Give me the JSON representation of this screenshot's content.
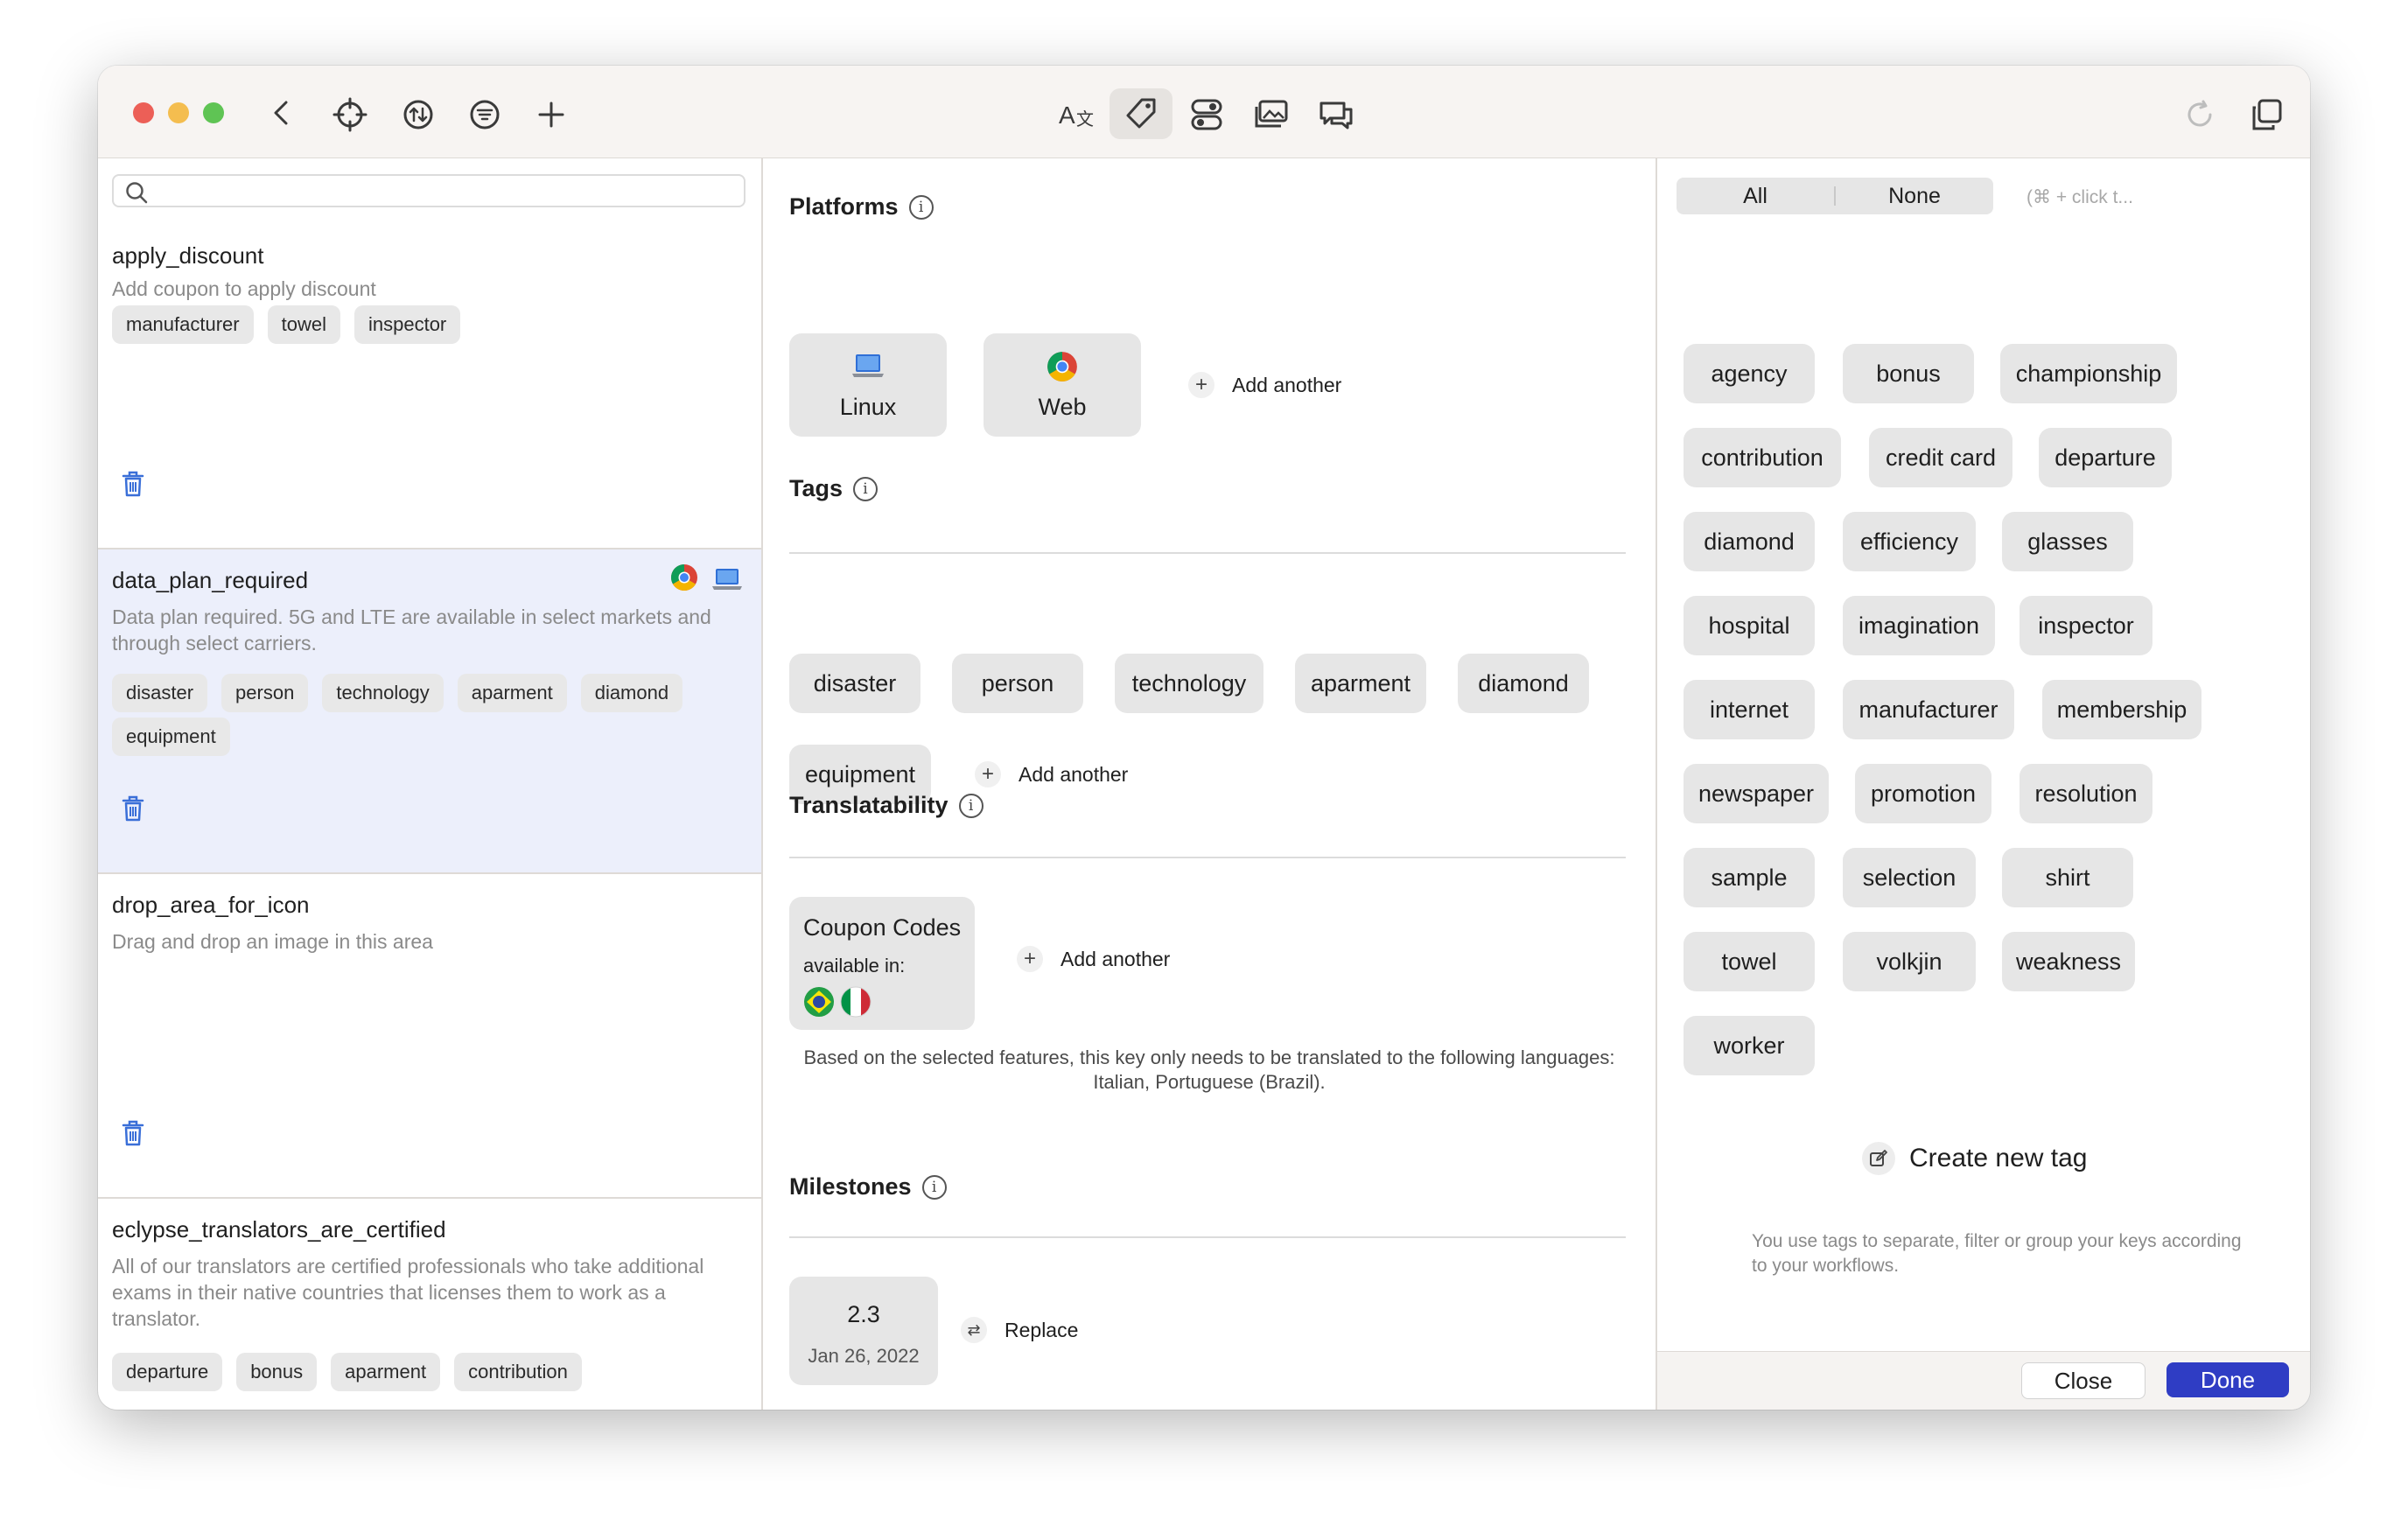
{
  "search": {
    "placeholder": ""
  },
  "keys": [
    {
      "name": "apply_discount",
      "description": "Add coupon to apply discount",
      "tags": [
        "manufacturer",
        "towel",
        "inspector"
      ]
    },
    {
      "name": "data_plan_required",
      "description": "Data plan required. 5G and LTE are available in select markets and through select carriers.",
      "tags": [
        "disaster",
        "person",
        "technology",
        "aparment",
        "diamond",
        "equipment"
      ]
    },
    {
      "name": "drop_area_for_icon",
      "description": "Drag and drop an image in this area",
      "tags": []
    },
    {
      "name": "eclypse_translators_are_certified",
      "description": "All of our translators are certified professionals who take additional exams in their native countries that licenses them to work as a translator.",
      "tags": [
        "departure",
        "bonus",
        "aparment",
        "contribution"
      ]
    }
  ],
  "platforms": {
    "title": "Platforms",
    "items": [
      {
        "label": "Linux",
        "icon": "laptop-icon"
      },
      {
        "label": "Web",
        "icon": "chrome-icon"
      }
    ],
    "add_label": "Add another"
  },
  "tags_section": {
    "title": "Tags",
    "items": [
      "disaster",
      "person",
      "technology",
      "aparment",
      "diamond",
      "equipment"
    ],
    "add_label": "Add another"
  },
  "translatability": {
    "title": "Translatability",
    "card_title": "Coupon Codes",
    "card_sub": "available in:",
    "flags": [
      "brazil-flag-icon",
      "italy-flag-icon"
    ],
    "add_label": "Add another",
    "note": "Based on the selected features, this key only needs to be translated to the following languages: Italian, Portuguese (Brazil)."
  },
  "milestones": {
    "title": "Milestones",
    "version": "2.3",
    "date": "Jan 26, 2022",
    "replace_label": "Replace"
  },
  "tag_picker": {
    "all_label": "All",
    "none_label": "None",
    "hint": "(⌘ + click t...",
    "tags": [
      "agency",
      "bonus",
      "championship",
      "contribution",
      "credit card",
      "departure",
      "diamond",
      "efficiency",
      "glasses",
      "hospital",
      "imagination",
      "inspector",
      "internet",
      "manufacturer",
      "membership",
      "newspaper",
      "promotion",
      "resolution",
      "sample",
      "selection",
      "shirt",
      "towel",
      "volkjin",
      "weakness",
      "worker"
    ],
    "create_label": "Create new tag",
    "help": "You use tags to separate, filter or group your keys according to your workflows."
  },
  "footer": {
    "close_label": "Close",
    "done_label": "Done"
  },
  "colors": {
    "accent": "#2f3dc4",
    "selected_row": "#eceffb",
    "trash": "#3a6fd8"
  }
}
